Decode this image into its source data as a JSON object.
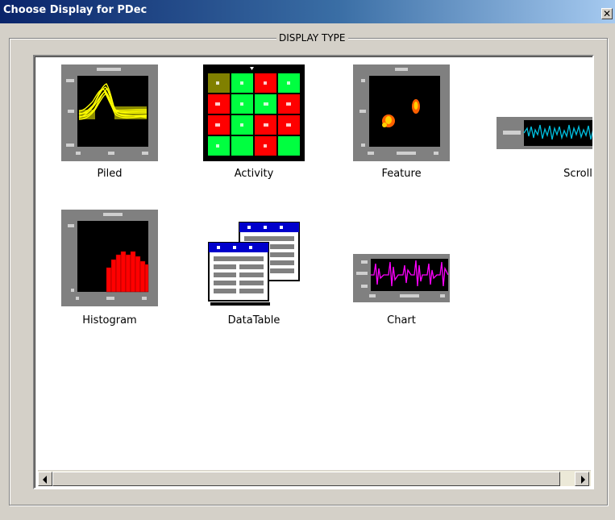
{
  "window": {
    "title": "Choose Display for PDec",
    "close_glyph": "✕"
  },
  "group": {
    "label": "DISPLAY TYPE"
  },
  "items": [
    {
      "label": "Piled",
      "icon": "piled-waveform-icon"
    },
    {
      "label": "Activity",
      "icon": "activity-grid-icon"
    },
    {
      "label": "Feature",
      "icon": "feature-scatter-icon"
    },
    {
      "label": "Scroll",
      "icon": "scroll-trace-icon"
    },
    {
      "label": "Histogram",
      "icon": "histogram-icon"
    },
    {
      "label": "DataTable",
      "icon": "data-table-icon"
    },
    {
      "label": "Chart",
      "icon": "chart-trace-icon"
    }
  ],
  "colors": {
    "title_bar_start": "#0a246a",
    "title_bar_end": "#a6caf0",
    "dialog_bg": "#d4d0c8",
    "activity_green": "#00ff40",
    "activity_red": "#ff0000",
    "piled_trace": "#ffff00",
    "scroll_trace": "#00c0e0",
    "histogram_bar": "#ff0000",
    "chart_trace": "#ff00ff",
    "table_header": "#0000cc"
  }
}
